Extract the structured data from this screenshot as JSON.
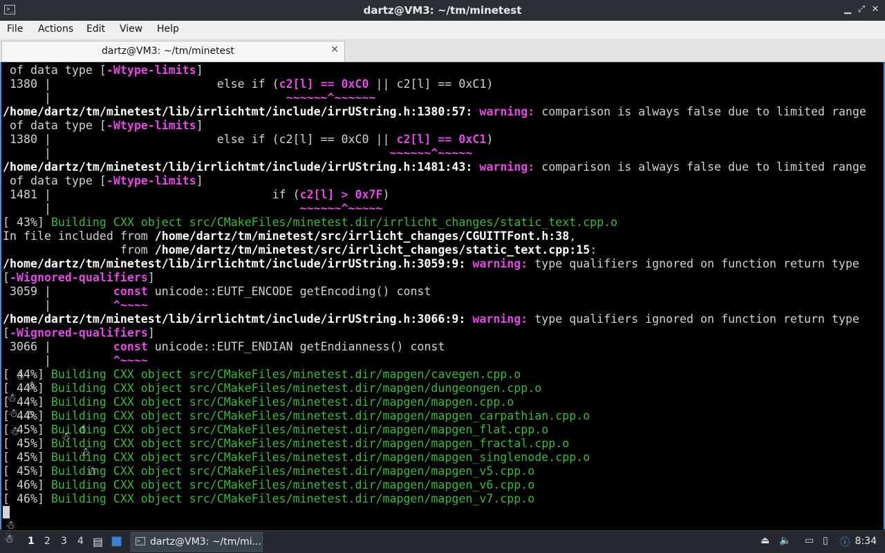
{
  "window": {
    "title": "dartz@VM3: ~/tm/minetest",
    "buttons": {
      "minimize": "▁",
      "maximize": "⤢",
      "close": "✕"
    }
  },
  "menu": [
    "File",
    "Actions",
    "Edit",
    "View",
    "Help"
  ],
  "tab": {
    "label": "dartz@VM3: ~/tm/minetest",
    "close": "✕"
  },
  "terminal": {
    "lines": [
      [
        [
          "",
          " of data type ["
        ],
        [
          "m",
          "-Wtype-limits"
        ],
        [
          "",
          "]"
        ]
      ],
      [
        [
          "",
          " 1380 |                        else if ("
        ],
        [
          "m",
          "c2[l] == 0xC0"
        ],
        [
          "",
          " || c2[l] == 0xC1)"
        ]
      ],
      [
        [
          "",
          "      |                                  "
        ],
        [
          "m",
          "~~~~~~^~~~~~~"
        ]
      ],
      [
        [
          "w",
          "/home/dartz/tm/minetest/lib/irrlichtmt/include/irrUString.h:1380:57: "
        ],
        [
          "m",
          "warning: "
        ],
        [
          "",
          "comparison is always false due to limited range"
        ]
      ],
      [
        [
          "",
          " of data type ["
        ],
        [
          "m",
          "-Wtype-limits"
        ],
        [
          "",
          "]"
        ]
      ],
      [
        [
          "",
          " 1380 |                        else if (c2[l] == 0xC0 || "
        ],
        [
          "m",
          "c2[l] == 0xC1"
        ],
        [
          "",
          ")"
        ]
      ],
      [
        [
          "",
          "      |                                                 "
        ],
        [
          "m",
          "~~~~~~^~~~~~"
        ]
      ],
      [
        [
          "w",
          "/home/dartz/tm/minetest/lib/irrlichtmt/include/irrUString.h:1481:43: "
        ],
        [
          "m",
          "warning: "
        ],
        [
          "",
          "comparison is always false due to limited range"
        ]
      ],
      [
        [
          "",
          " of data type ["
        ],
        [
          "m",
          "-Wtype-limits"
        ],
        [
          "",
          "]"
        ]
      ],
      [
        [
          "",
          " 1481 |                                if ("
        ],
        [
          "m",
          "c2[l] > 0x7F"
        ],
        [
          "",
          ")"
        ]
      ],
      [
        [
          "",
          "      |                                    "
        ],
        [
          "m",
          "~~~~~~^~~~~~"
        ]
      ],
      [
        [
          "",
          "[ 43%] "
        ],
        [
          "g",
          "Building CXX object src/CMakeFiles/minetest.dir/irrlicht_changes/static_text.cpp.o"
        ]
      ],
      [
        [
          "",
          "In file included from "
        ],
        [
          "w",
          "/home/dartz/tm/minetest/src/irrlicht_changes/CGUITTFont.h:38"
        ],
        [
          "",
          ","
        ]
      ],
      [
        [
          "",
          "                 from "
        ],
        [
          "w",
          "/home/dartz/tm/minetest/src/irrlicht_changes/static_text.cpp:15"
        ],
        [
          "",
          ":"
        ]
      ],
      [
        [
          "w",
          "/home/dartz/tm/minetest/lib/irrlichtmt/include/irrUString.h:3059:9: "
        ],
        [
          "m",
          "warning: "
        ],
        [
          "",
          "type qualifiers ignored on function return type"
        ]
      ],
      [
        [
          "",
          "["
        ],
        [
          "m",
          "-Wignored-qualifiers"
        ],
        [
          "",
          "]"
        ]
      ],
      [
        [
          "",
          " 3059 |         "
        ],
        [
          "m",
          "const"
        ],
        [
          "",
          " unicode::EUTF_ENCODE getEncoding() const"
        ]
      ],
      [
        [
          "",
          "      |         "
        ],
        [
          "m",
          "^~~~~"
        ]
      ],
      [
        [
          "w",
          "/home/dartz/tm/minetest/lib/irrlichtmt/include/irrUString.h:3066:9: "
        ],
        [
          "m",
          "warning: "
        ],
        [
          "",
          "type qualifiers ignored on function return type"
        ]
      ],
      [
        [
          "",
          "["
        ],
        [
          "m",
          "-Wignored-qualifiers"
        ],
        [
          "",
          "]"
        ]
      ],
      [
        [
          "",
          " 3066 |         "
        ],
        [
          "m",
          "const"
        ],
        [
          "",
          " unicode::EUTF_ENDIAN getEndianness() const"
        ]
      ],
      [
        [
          "",
          "      |         "
        ],
        [
          "m",
          "^~~~~"
        ]
      ],
      [
        [
          "",
          "[ 44%] "
        ],
        [
          "g",
          "Building CXX object src/CMakeFiles/minetest.dir/mapgen/cavegen.cpp.o"
        ]
      ],
      [
        [
          "",
          "[ 44%] "
        ],
        [
          "g",
          "Building CXX object src/CMakeFiles/minetest.dir/mapgen/dungeongen.cpp.o"
        ]
      ],
      [
        [
          "",
          "[ 44%] "
        ],
        [
          "g",
          "Building CXX object src/CMakeFiles/minetest.dir/mapgen/mapgen.cpp.o"
        ]
      ],
      [
        [
          "",
          "[ 44%] "
        ],
        [
          "g",
          "Building CXX object src/CMakeFiles/minetest.dir/mapgen/mapgen_carpathian.cpp.o"
        ]
      ],
      [
        [
          "",
          "[ 45%] "
        ],
        [
          "g",
          "Building CXX object src/CMakeFiles/minetest.dir/mapgen/mapgen_flat.cpp.o"
        ]
      ],
      [
        [
          "",
          "[ 45%] "
        ],
        [
          "g",
          "Building CXX object src/CMakeFiles/minetest.dir/mapgen/mapgen_fractal.cpp.o"
        ]
      ],
      [
        [
          "",
          "[ 45%] "
        ],
        [
          "g",
          "Building CXX object src/CMakeFiles/minetest.dir/mapgen/mapgen_singlenode.cpp.o"
        ]
      ],
      [
        [
          "",
          "[ 45%] "
        ],
        [
          "g",
          "Building CXX object src/CMakeFiles/minetest.dir/mapgen/mapgen_v5.cpp.o"
        ]
      ],
      [
        [
          "",
          "[ 46%] "
        ],
        [
          "g",
          "Building CXX object src/CMakeFiles/minetest.dir/mapgen/mapgen_v6.cpp.o"
        ]
      ],
      [
        [
          "",
          "[ 46%] "
        ],
        [
          "g",
          "Building CXX object src/CMakeFiles/minetest.dir/mapgen/mapgen_v7.cpp.o"
        ]
      ]
    ]
  },
  "taskbar": {
    "workspaces": [
      "1",
      "2",
      "3",
      "4"
    ],
    "task_label": "dartz@VM3: ~/tm/mi...",
    "clock": "8:34"
  },
  "colors": {
    "accent": "#4a90d9",
    "warning": "#e24ce2",
    "build": "#3fb83f",
    "taskbar": "#252a30"
  }
}
